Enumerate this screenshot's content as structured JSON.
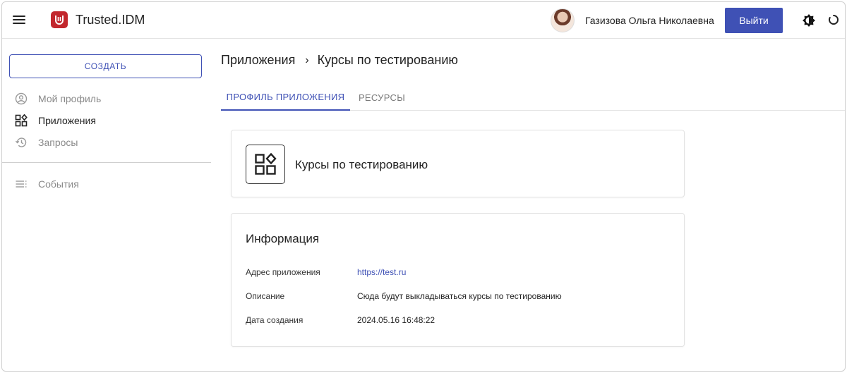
{
  "header": {
    "app_title": "Trusted.IDM",
    "user_name": "Газизова Ольга Николаевна",
    "logout_label": "Выйти",
    "icons": [
      "menu-icon",
      "app-logo-icon",
      "avatar",
      "theme-toggle-icon",
      "loading-spinner-icon"
    ],
    "accent_color": "#3f51b5",
    "logo_color": "#c2272d"
  },
  "sidebar": {
    "create_label": "СОЗДАТЬ",
    "items": [
      {
        "label": "Мой профиль",
        "icon": "account-circle-icon",
        "state": "muted"
      },
      {
        "label": "Приложения",
        "icon": "apps-widgets-icon",
        "state": "active"
      },
      {
        "label": "Запросы",
        "icon": "history-icon",
        "state": "muted"
      },
      {
        "label": "События",
        "icon": "list-lines-icon",
        "state": "muted"
      }
    ]
  },
  "breadcrumb": {
    "root": "Приложения",
    "separator": "›",
    "current": "Курсы по тестированию"
  },
  "tabs": [
    {
      "label": "ПРОФИЛЬ ПРИЛОЖЕНИЯ",
      "active": true
    },
    {
      "label": "РЕСУРСЫ",
      "active": false
    }
  ],
  "app_card": {
    "title": "Курсы по тестированию",
    "icon": "apps-widgets-icon"
  },
  "info_card": {
    "heading": "Информация",
    "rows": [
      {
        "key": "Адрес приложения",
        "value": "https://test.ru",
        "is_link": true
      },
      {
        "key": "Описание",
        "value": "Сюда будут выкладываться курсы по тестированию",
        "is_link": false
      },
      {
        "key": "Дата создания",
        "value": "2024.05.16 16:48:22",
        "is_link": false
      }
    ]
  }
}
